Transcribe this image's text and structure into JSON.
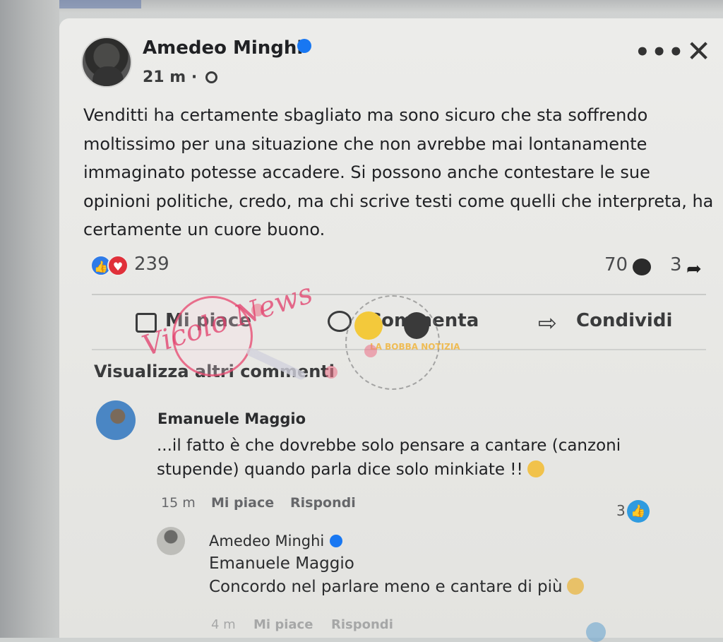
{
  "post": {
    "author": "Amedeo Minghi",
    "time": "21 m",
    "meta_separator": "·",
    "body": "Venditti ha certamente sbagliato ma sono sicuro che sta soffrendo moltissimo per una situazione che non avrebbe mai lontanamente immaginato potesse accadere. Si possono anche contestare le sue opinioni politiche, credo, ma chi scrive testi come quelli che interpreta, ha certamente un cuore buono.",
    "more_label": "•••",
    "close_label": "✕",
    "reactions_count": "239",
    "comments_count": "70",
    "shares_count": "3"
  },
  "actions": {
    "like": "Mi piace",
    "comment": "Commenta",
    "share": "Condividi"
  },
  "more_comments": "Visualizza altri commenti",
  "comments": [
    {
      "author": "Emanuele Maggio",
      "text": "...il fatto è che dovrebbe solo pensare a cantare (canzoni stupende) quando parla dice solo minkiate !!",
      "time": "15 m",
      "like_label": "Mi piace",
      "reply_label": "Rispondi",
      "likes": "3"
    }
  ],
  "reply": {
    "author": "Amedeo Minghi",
    "mention": "Emanuele Maggio",
    "text": "Concordo nel parlare meno e cantare di più",
    "time": "4 m",
    "like_label": "Mi piace",
    "reply_label": "Rispondi"
  },
  "watermark": {
    "logo_text": "Vicolo News",
    "small_text": "LA BOBBA NOTIZIA"
  },
  "colors": {
    "accent": "#1877f2",
    "love": "#e0303a",
    "watermark": "#e13c69"
  }
}
